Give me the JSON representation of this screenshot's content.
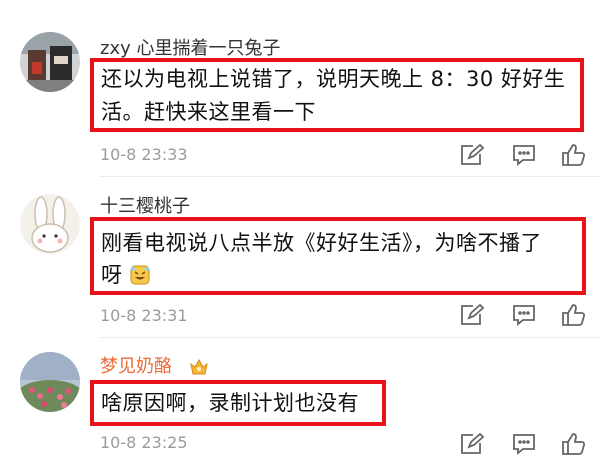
{
  "comments": [
    {
      "username": "zxy 心里揣着一只兔子",
      "text_line1": "还以为电视上说错了，说明天晚上 8：30 好好生",
      "text_line2": "活。赶快来这里看一下",
      "time": "10-8 23:33"
    },
    {
      "username": "十三樱桃子",
      "text_line1": "刚看电视说八点半放《好好生活》，为啥不播了",
      "text_line2": "呀",
      "time": "10-8 23:31"
    },
    {
      "username": "梦见奶酪",
      "text_line1": "啥原因啊，录制计划也没有",
      "time": "10-8 23:25"
    }
  ],
  "icons": {
    "edit": "edit-icon",
    "reply": "comment-icon",
    "like": "thumbs-up-icon",
    "emoji": "laughing-emoji-icon",
    "vip": "vip-badge-icon"
  },
  "colors": {
    "highlight_border": "#e8121b",
    "vip_name": "#ef6a35",
    "time": "#9b9b9b"
  }
}
